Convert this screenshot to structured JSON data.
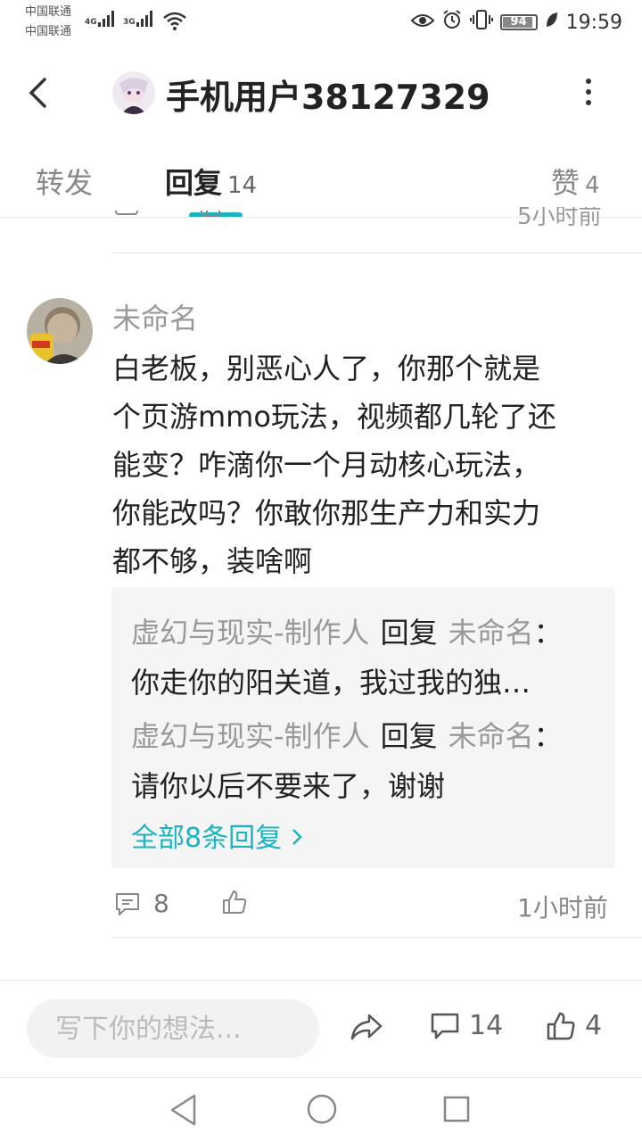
{
  "status_bar": {
    "carrier_1": "中国联通",
    "carrier_2": "中国联通",
    "net_1": "4G",
    "net_2": "3G",
    "battery": "94",
    "time": "19:59"
  },
  "header": {
    "title": "手机用户38127329",
    "back_icon": "chevron-left-icon",
    "more_icon": "more-vertical-icon"
  },
  "tabs": [
    {
      "label": "转发",
      "count": ""
    },
    {
      "label": "回复",
      "count": "14"
    },
    {
      "label": "赞",
      "count": "4"
    }
  ],
  "active_tab": "回复",
  "accent_color": "#1bb3c1",
  "previous_item": {
    "time": "5小时前"
  },
  "comment": {
    "username": "未命名",
    "text_lines": [
      "白老板，别恶心人了，你那个就是",
      "个页游mmo玩法，视频都几轮了还",
      "能变？咋滴你一个月动核心玩法，",
      "你能改吗？你敢你那生产力和实力",
      "都不够，装啥啊"
    ],
    "replies": [
      {
        "from": "虚幻与现实-制作人",
        "verb": "回复",
        "to": "未命名",
        "colon": "：",
        "text": "你走你的阳关道，我过我的独…"
      },
      {
        "from": "虚幻与现实-制作人",
        "verb": "回复",
        "to": "未命名",
        "colon": "：",
        "text": "请你以后不要来了，谢谢"
      }
    ],
    "all_replies": "全部8条回复",
    "reply_count": "8",
    "time": "1小时前"
  },
  "bottom_bar": {
    "input_placeholder": "写下你的想法...",
    "reply_count": "14",
    "like_count": "4"
  }
}
